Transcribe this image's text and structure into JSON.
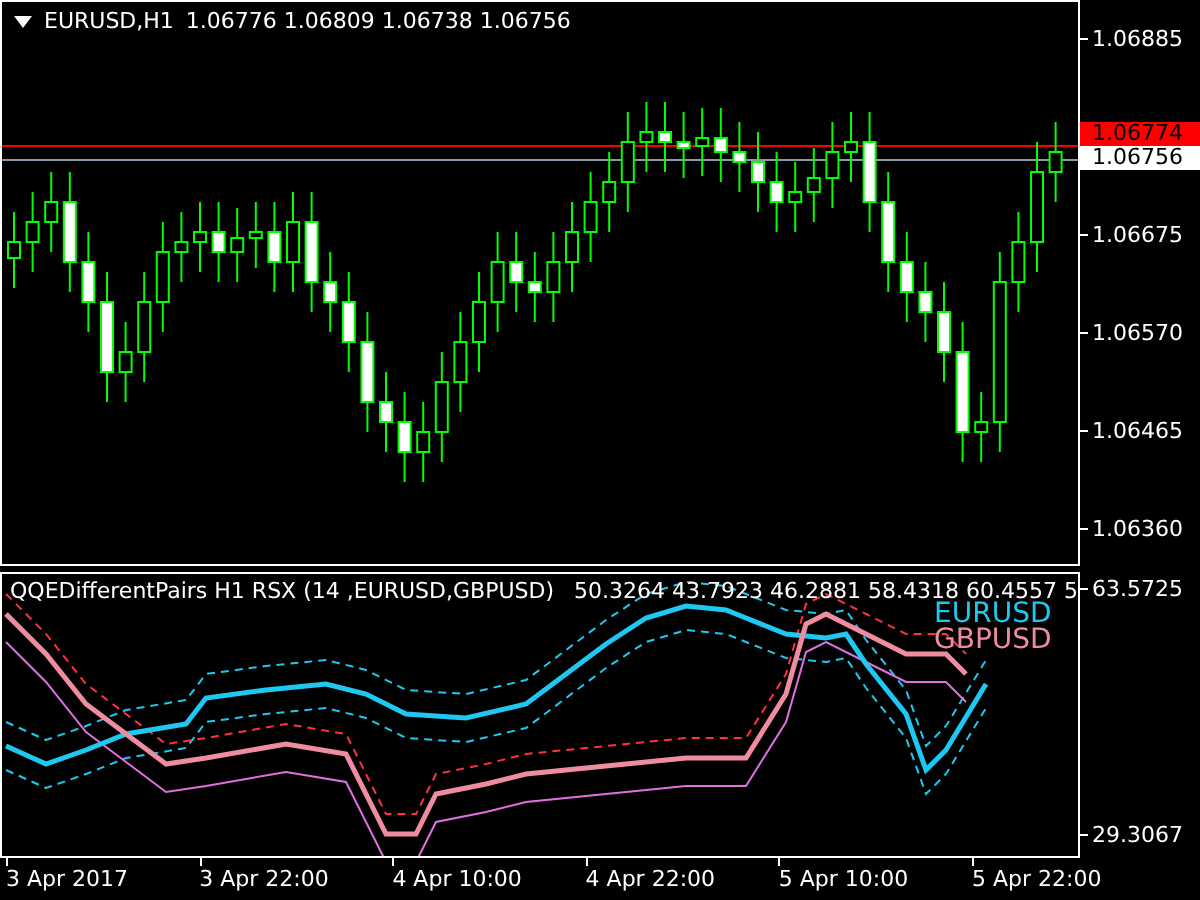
{
  "main_chart": {
    "symbol_label": "EURUSD,H1",
    "ohlc": [
      "1.06776",
      "1.06809",
      "1.06738",
      "1.06756"
    ],
    "price_ticks": [
      "1.06885",
      "1.06675",
      "1.06570",
      "1.06465",
      "1.06360"
    ],
    "line_badges": [
      {
        "text": "1.06774",
        "kind": "alert"
      },
      {
        "text": "1.06756",
        "kind": "bid"
      }
    ]
  },
  "indicator": {
    "title": "QQEDifferentPairs H1 RSX (14 ,EURUSD,GBPUSD)",
    "values": "50.3264 43.7923 46.2881 58.4318 60.4557 5",
    "legend": [
      {
        "label": "EURUSD",
        "color": "#1ec8f0"
      },
      {
        "label": "GBPUSD",
        "color": "#f08ca0"
      }
    ],
    "scale": [
      "63.5725",
      "29.3067"
    ]
  },
  "time_axis": [
    "3 Apr 2017",
    "3 Apr 22:00",
    "4 Apr 10:00",
    "4 Apr 22:00",
    "5 Apr 10:00",
    "5 Apr 22:00"
  ]
}
